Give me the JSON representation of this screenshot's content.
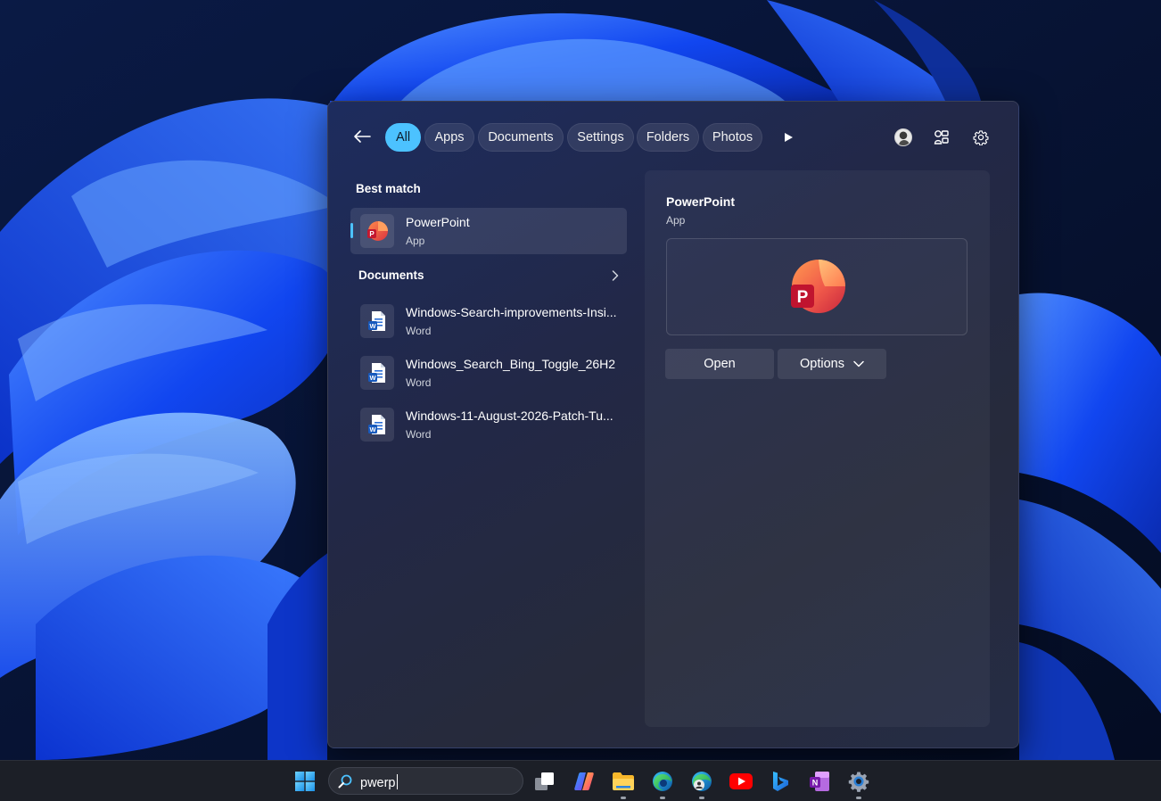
{
  "search_flyout": {
    "filters": [
      {
        "label": "All",
        "active": true
      },
      {
        "label": "Apps",
        "active": false
      },
      {
        "label": "Documents",
        "active": false
      },
      {
        "label": "Settings",
        "active": false
      },
      {
        "label": "Folders",
        "active": false
      },
      {
        "label": "Photos",
        "active": false
      }
    ],
    "top_icons": [
      "back-arrow-icon",
      "more-play-icon",
      "account-avatar-icon",
      "share-connections-icon",
      "gear-icon"
    ],
    "best_match": {
      "heading": "Best match",
      "item": {
        "title": "PowerPoint",
        "subtitle": "App",
        "icon": "powerpoint-icon"
      }
    },
    "documents": {
      "heading": "Documents",
      "items": [
        {
          "title": "Windows-Search-improvements-Insi...",
          "subtitle": "Word",
          "icon": "word-doc-icon"
        },
        {
          "title": "Windows_Search_Bing_Toggle_26H2",
          "subtitle": "Word",
          "icon": "word-doc-icon"
        },
        {
          "title": "Windows-11-August-2026-Patch-Tu...",
          "subtitle": "Word",
          "icon": "word-doc-icon"
        }
      ]
    },
    "preview": {
      "title": "PowerPoint",
      "subtitle": "App",
      "open_label": "Open",
      "options_label": "Options"
    }
  },
  "taskbar": {
    "search_query": "pwerp",
    "apps": [
      "start-icon",
      "task-view-icon",
      "copilot-icon",
      "file-explorer-icon",
      "edge-icon",
      "edge-profile-icon",
      "youtube-icon",
      "bing-icon",
      "onenote-icon",
      "settings-icon"
    ]
  },
  "colors": {
    "accent": "#4cc2ff",
    "flyout_bg": "#232a45",
    "taskbar_bg": "#1c1f27"
  }
}
